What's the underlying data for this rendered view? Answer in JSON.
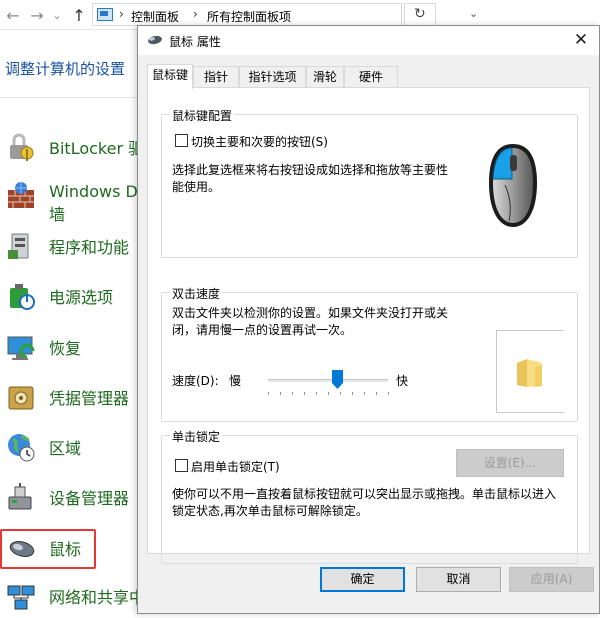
{
  "control_panel": {
    "breadcrumbs": [
      "控制面板",
      "所有控制面板项"
    ],
    "heading": "调整计算机的设置",
    "items": [
      {
        "label": "BitLocker 驱",
        "icon": "bitlocker-icon"
      },
      {
        "label": "Windows D",
        "label2": "墙",
        "icon": "firewall-icon"
      },
      {
        "label": "程序和功能",
        "icon": "programs-icon"
      },
      {
        "label": "电源选项",
        "icon": "power-options-icon"
      },
      {
        "label": "恢复",
        "icon": "recovery-icon"
      },
      {
        "label": "凭据管理器",
        "icon": "credential-manager-icon"
      },
      {
        "label": "区域",
        "icon": "region-icon"
      },
      {
        "label": "设备管理器",
        "icon": "device-manager-icon"
      },
      {
        "label": "鼠标",
        "icon": "mouse-icon"
      },
      {
        "label": "网络和共享中",
        "icon": "network-icon"
      }
    ],
    "highlight_color": "#e53935"
  },
  "dialog": {
    "title": "鼠标 属性",
    "tabs": [
      "鼠标键",
      "指针",
      "指针选项",
      "滑轮",
      "硬件"
    ],
    "active_tab": "鼠标键",
    "button_config": {
      "title": "鼠标键配置",
      "checkbox_label": "切换主要和次要的按钮(S)",
      "checked": false,
      "description": "选择此复选框来将右按钮设成如选择和拖放等主要性能使用。"
    },
    "double_click": {
      "title": "双击速度",
      "description": "双击文件夹以检测你的设置。如果文件夹没打开或关闭，请用慢一点的设置再试一次。",
      "speed_label": "速度(D):",
      "slow_label": "慢",
      "fast_label": "快",
      "speed_value_fraction": 0.58
    },
    "click_lock": {
      "title": "单击锁定",
      "checkbox_label": "启用单击锁定(T)",
      "checked": false,
      "settings_button": "设置(E)...",
      "description": "使你可以不用一直按着鼠标按钮就可以突出显示或拖拽。单击鼠标以进入锁定状态,再次单击鼠标可解除锁定。"
    },
    "buttons": {
      "ok": "确定",
      "cancel": "取消",
      "apply": "应用(A)"
    },
    "accent_color": "#0078d7"
  }
}
